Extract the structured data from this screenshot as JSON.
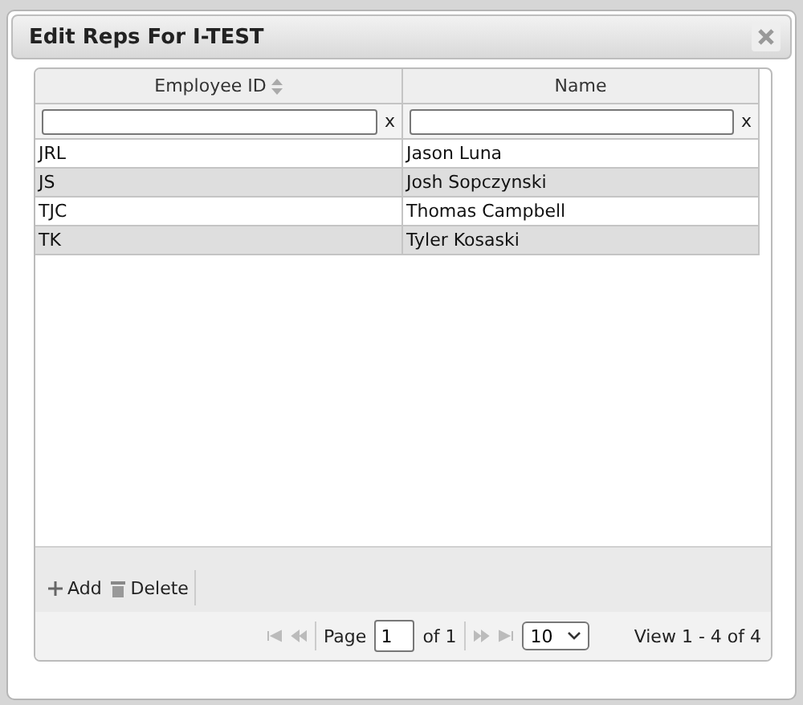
{
  "dialog": {
    "title": "Edit Reps For I-TEST"
  },
  "table": {
    "columns": [
      {
        "label": "Employee ID",
        "sortable": true
      },
      {
        "label": "Name",
        "sortable": false
      }
    ],
    "filters": [
      {
        "clear": "x"
      },
      {
        "clear": "x"
      }
    ],
    "rows": [
      [
        "JRL",
        "Jason Luna"
      ],
      [
        "JS",
        "Josh Sopczynski"
      ],
      [
        "TJC",
        "Thomas Campbell"
      ],
      [
        "TK",
        "Tyler Kosaski"
      ]
    ]
  },
  "toolbar": [
    {
      "kind": "add",
      "label": "Add"
    },
    {
      "kind": "delete",
      "label": "Delete"
    }
  ],
  "pager": {
    "page_label": "Page",
    "page": "1",
    "of_label": "of 1",
    "page_size": "10",
    "summary": "View 1 - 4 of 4"
  }
}
